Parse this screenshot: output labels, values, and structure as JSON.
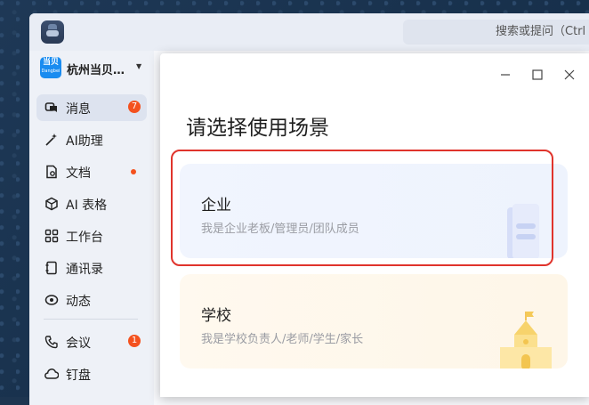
{
  "search": {
    "placeholder": "搜索或提问（Ctrl"
  },
  "org": {
    "logo_text": "当贝",
    "logo_sub": "Dangbei",
    "name": "杭州当贝…"
  },
  "nav": {
    "items": [
      {
        "label": "消息",
        "badge": "7"
      },
      {
        "label": "AI助理"
      },
      {
        "label": "文档"
      },
      {
        "label": "AI 表格"
      },
      {
        "label": "工作台"
      },
      {
        "label": "通讯录"
      },
      {
        "label": "动态"
      },
      {
        "label": "会议",
        "badge": "1"
      },
      {
        "label": "钉盘"
      }
    ]
  },
  "modal": {
    "title": "请选择使用场景",
    "cards": [
      {
        "title": "企业",
        "desc": "我是企业老板/管理员/团队成员"
      },
      {
        "title": "学校",
        "desc": "我是学校负责人/老师/学生/家长"
      }
    ]
  },
  "colors": {
    "badge": "#f4511e",
    "highlight": "#e0342c",
    "accent": "#1a8cf0"
  }
}
